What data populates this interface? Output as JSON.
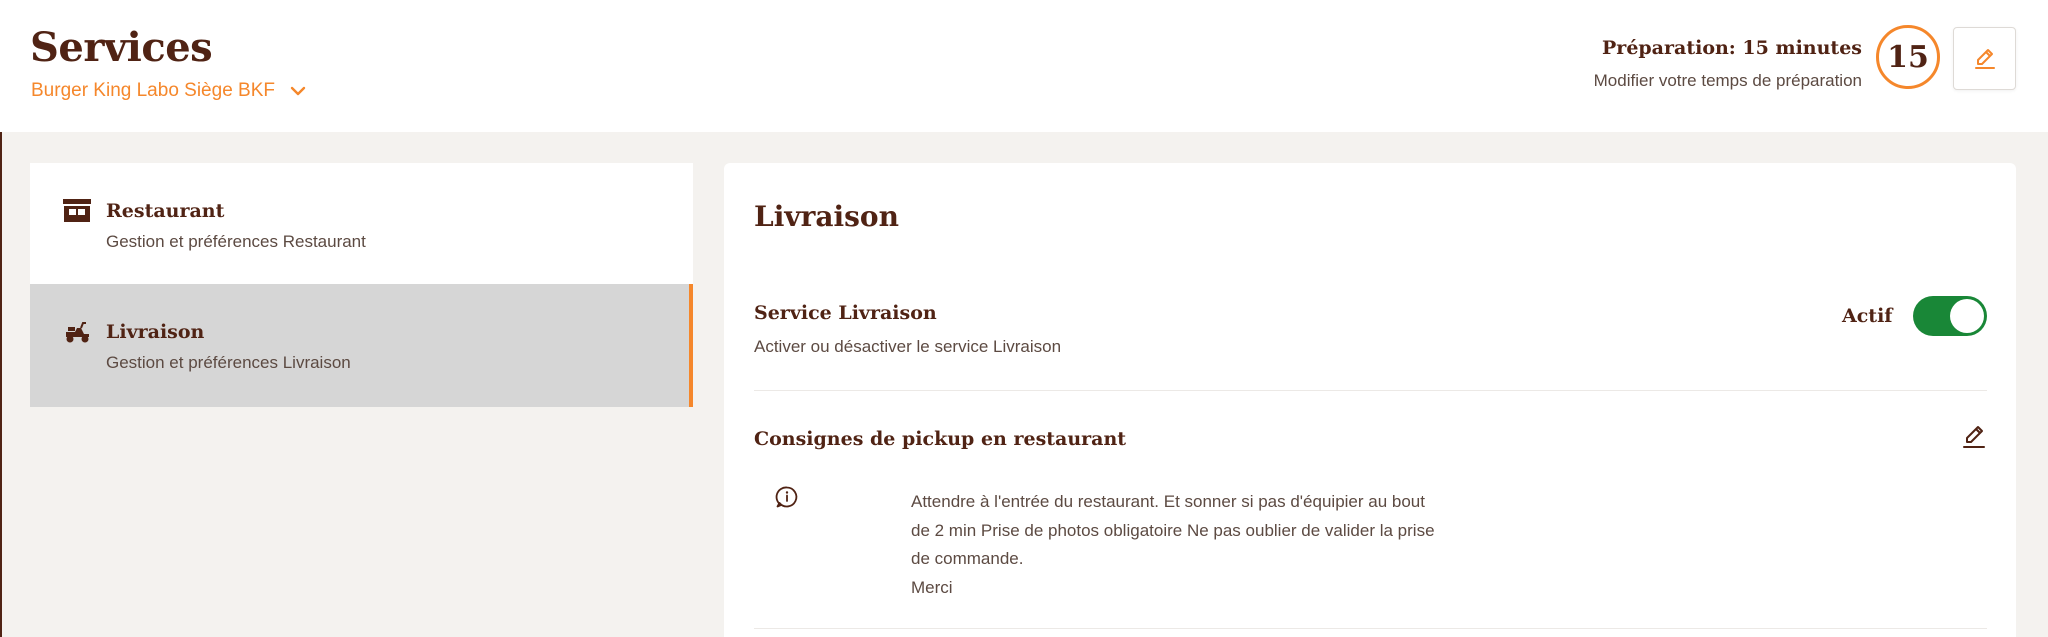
{
  "header": {
    "title": "Services",
    "restaurant_name": "Burger King Labo Siège BKF",
    "prep_title": "Préparation: 15 minutes",
    "prep_subtitle": "Modifier votre temps de préparation",
    "prep_minutes": "15"
  },
  "sidebar": {
    "items": [
      {
        "title": "Restaurant",
        "description": "Gestion et préférences Restaurant",
        "icon": "store-icon",
        "active": false
      },
      {
        "title": "Livraison",
        "description": "Gestion et préférences Livraison",
        "icon": "scooter-icon",
        "active": true
      }
    ]
  },
  "panel": {
    "title": "Livraison",
    "service": {
      "title": "Service Livraison",
      "description": "Activer ou désactiver le service Livraison",
      "status_label": "Actif",
      "enabled": true
    },
    "pickup": {
      "title": "Consignes de pickup en restaurant",
      "instructions": "Attendre à l'entrée du restaurant. Et sonner si pas d'équipier au bout\nde 2 min Prise de photos obligatoire Ne pas oublier de valider la prise\nde commande.\nMerci"
    }
  },
  "colors": {
    "brown": "#502314",
    "orange": "#f5872b",
    "toggle_green": "#198737",
    "active_bg": "#d6d6d6",
    "page_bg": "#f4f2ef"
  }
}
